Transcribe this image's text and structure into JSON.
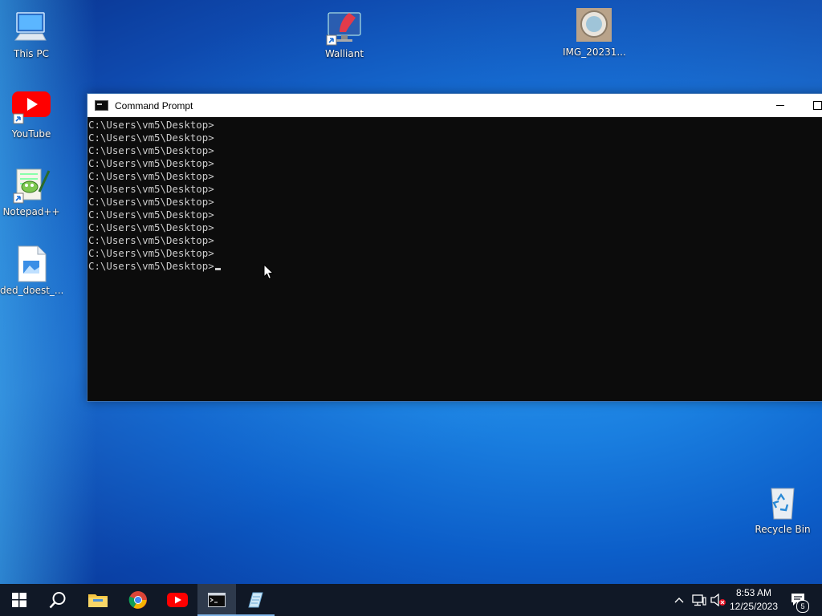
{
  "desktop": {
    "icons": [
      {
        "label": "This PC"
      },
      {
        "label": "YouTube"
      },
      {
        "label": "Notepad++"
      },
      {
        "label": "ded_doest_..."
      },
      {
        "label": "Walliant"
      },
      {
        "label": "IMG_20231..."
      },
      {
        "label": "Recycle Bin"
      }
    ]
  },
  "cmd": {
    "title": "Command Prompt",
    "lines": [
      "C:\\Users\\vm5\\Desktop>",
      "C:\\Users\\vm5\\Desktop>",
      "C:\\Users\\vm5\\Desktop>",
      "C:\\Users\\vm5\\Desktop>",
      "C:\\Users\\vm5\\Desktop>",
      "C:\\Users\\vm5\\Desktop>",
      "C:\\Users\\vm5\\Desktop>",
      "C:\\Users\\vm5\\Desktop>",
      "C:\\Users\\vm5\\Desktop>",
      "C:\\Users\\vm5\\Desktop>",
      "C:\\Users\\vm5\\Desktop>",
      "C:\\Users\\vm5\\Desktop>"
    ],
    "background": "#0c0c0c",
    "text_color": "#cccccc"
  },
  "taskbar": {
    "apps": [
      "start-icon",
      "search-icon",
      "file-explorer-icon",
      "chrome-icon",
      "youtube-icon",
      "command-prompt-icon",
      "notepad-icon"
    ],
    "active": "command-prompt-icon",
    "clock": {
      "time": "8:53 AM",
      "date": "12/25/2023"
    },
    "notification_count": "5"
  },
  "colors": {
    "taskbar": "#101826",
    "accent": "#7fb4e8",
    "youtube": "#ff0000"
  }
}
